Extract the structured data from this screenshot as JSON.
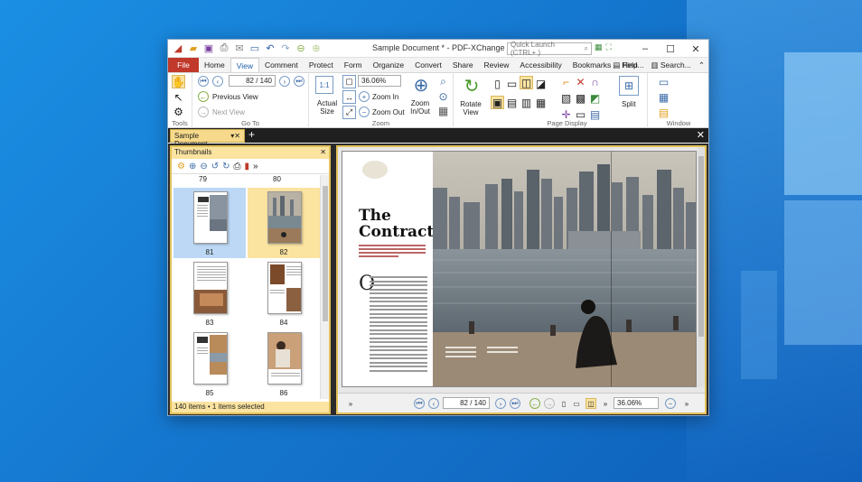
{
  "app": {
    "title": "Sample Document * - PDF-XChange Editor",
    "quick_launch_placeholder": "Quick Launch (CTRL+.)"
  },
  "menu": {
    "tabs": [
      "File",
      "Home",
      "View",
      "Comment",
      "Protect",
      "Form",
      "Organize",
      "Convert",
      "Share",
      "Review",
      "Accessibility",
      "Bookmarks",
      "Help"
    ],
    "active": "View",
    "find_label": "Find...",
    "search_label": "Search..."
  },
  "ribbon": {
    "tools": {
      "label": "Tools"
    },
    "goto": {
      "label": "Go To",
      "page_value": "82 / 140",
      "previous_view": "Previous View",
      "next_view": "Next View"
    },
    "zoom": {
      "label": "Zoom",
      "actual_size": "Actual Size",
      "zoom_value": "36.06%",
      "zoom_in": "Zoom In",
      "zoom_out": "Zoom Out",
      "zoom_in_out": "Zoom In/Out",
      "rotate_view": "Rotate View"
    },
    "page_display": {
      "label": "Page Display",
      "split": "Split"
    },
    "window": {
      "label": "Window"
    }
  },
  "document_tab": {
    "label": "Sample Document"
  },
  "thumbnails": {
    "header": "Thumbnails",
    "top_labels": [
      "79",
      "80"
    ],
    "pages": [
      "81",
      "82",
      "83",
      "84",
      "85",
      "86"
    ],
    "status": "140 items • 1 items selected"
  },
  "article": {
    "title_line1": "The",
    "title_line2": "Contract",
    "dropcap": "O"
  },
  "navbar": {
    "page_value": "82 / 140",
    "zoom_value": "36.06%"
  },
  "colors": {
    "file_tab": "#c0392b",
    "highlight": "#fbe3a0",
    "selection": "#bcd8f4",
    "desktop": "#1577cf"
  }
}
